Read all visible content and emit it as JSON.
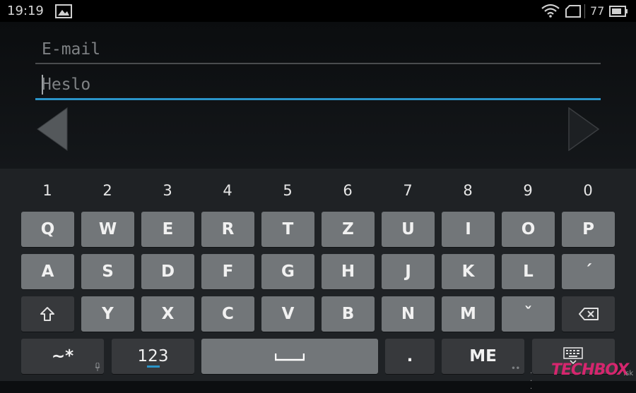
{
  "status_bar": {
    "time": "19:19",
    "battery_level": "77",
    "icons": [
      "image-icon",
      "wifi-icon",
      "tablet-icon",
      "battery-icon"
    ]
  },
  "form": {
    "email_placeholder": "E-mail",
    "password_placeholder": "Heslo",
    "focused_field": "password"
  },
  "keyboard": {
    "numbers": [
      "1",
      "2",
      "3",
      "4",
      "5",
      "6",
      "7",
      "8",
      "9",
      "0"
    ],
    "row1": [
      "Q",
      "W",
      "E",
      "R",
      "T",
      "Z",
      "U",
      "I",
      "O",
      "P"
    ],
    "row2": [
      "A",
      "S",
      "D",
      "F",
      "G",
      "H",
      "J",
      "K",
      "L",
      "´"
    ],
    "row3": [
      "Y",
      "X",
      "C",
      "V",
      "B",
      "N",
      "M",
      "ˇ"
    ],
    "symbols_label": "~*",
    "numeric_label": "123",
    "period_label": ".",
    "language_label": "ME",
    "space_glyph": "␣"
  },
  "watermark": {
    "brand": "TECHBOX",
    "suffix": ".sk"
  },
  "colors": {
    "accent": "#2a94c8",
    "key": "#727679",
    "key_dark": "#37393c",
    "keyboard_bg": "#1f2225",
    "brand": "#d5266e"
  }
}
